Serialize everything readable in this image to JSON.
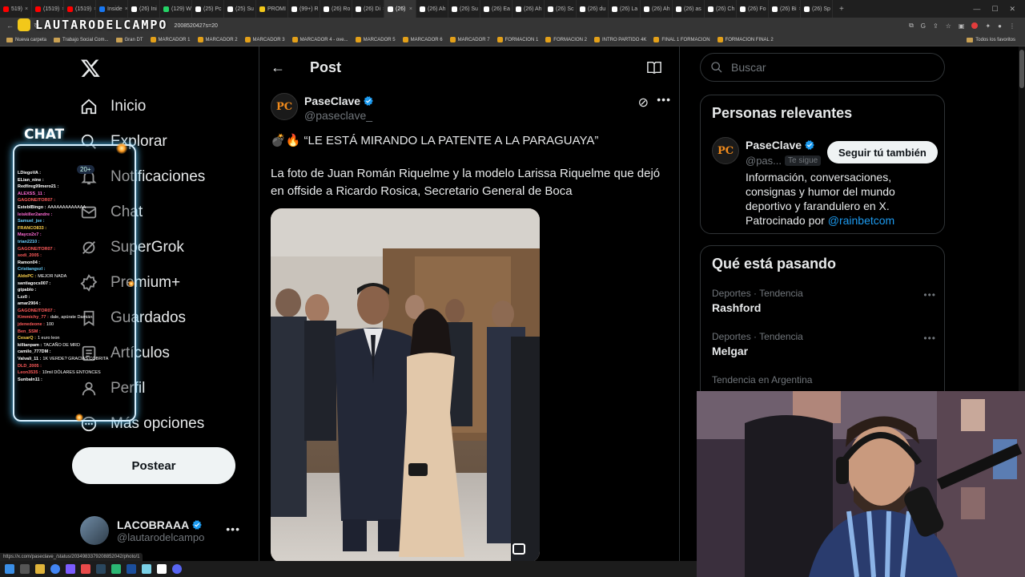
{
  "browser": {
    "tabs": [
      {
        "label": "519)",
        "color": "#ff0000"
      },
      {
        "label": "(1519)",
        "color": "#ff0000"
      },
      {
        "label": "(1519)",
        "color": "#ff0000"
      },
      {
        "label": "Inside",
        "color": "#1877f2"
      },
      {
        "label": "(26) Ini",
        "color": "#ffffff"
      },
      {
        "label": "(129) W",
        "color": "#25d366"
      },
      {
        "label": "(25) Pc",
        "color": "#ffffff"
      },
      {
        "label": "(25) Su",
        "color": "#ffffff"
      },
      {
        "label": "PROMI",
        "color": "#f2c81a"
      },
      {
        "label": "(99+) R",
        "color": "#ffffff"
      },
      {
        "label": "(26) Ro",
        "color": "#ffffff"
      },
      {
        "label": "(26) Di",
        "color": "#ffffff"
      },
      {
        "label": "(26)",
        "color": "#ffffff",
        "active": true
      },
      {
        "label": "(26) Ah",
        "color": "#ffffff"
      },
      {
        "label": "(26) Su",
        "color": "#ffffff"
      },
      {
        "label": "(26) Ea",
        "color": "#ffffff"
      },
      {
        "label": "(26) Ah",
        "color": "#ffffff"
      },
      {
        "label": "(26) Sc",
        "color": "#ffffff"
      },
      {
        "label": "(26) du",
        "color": "#ffffff"
      },
      {
        "label": "(26) La",
        "color": "#ffffff"
      },
      {
        "label": "(26) Ah",
        "color": "#ffffff"
      },
      {
        "label": "(26) as",
        "color": "#ffffff"
      },
      {
        "label": "(26) Ch",
        "color": "#ffffff"
      },
      {
        "label": "(26) Fo",
        "color": "#ffffff"
      },
      {
        "label": "(26) Bi",
        "color": "#ffffff"
      },
      {
        "label": "(26) Sp",
        "color": "#ffffff"
      }
    ],
    "url": "2008520427s=20",
    "bookmarks": [
      "Nueva carpeta",
      "Trabajo Social Com...",
      "Gran DT",
      "MARCADOR 1",
      "MARCADOR 2",
      "MARCADOR 3",
      "MARCADOR 4 - ove...",
      "MARCADOR 5",
      "MARCADOR 6",
      "MARCADOR 7",
      "FORMACION 1",
      "FORMACION 2",
      "INTRO PARTIDO 4K",
      "FINAL 1 FORMACION",
      "FORMACION FINAL 2"
    ],
    "all_bookmarks": "Todos los favoritos",
    "status_url": "https://x.com/paseclave_/status/2034983379208852042/photo/1"
  },
  "nav": {
    "items": [
      {
        "label": "Inicio",
        "icon": "home-icon"
      },
      {
        "label": "Explorar",
        "icon": "search-icon"
      },
      {
        "label": "Notificaciones",
        "icon": "bell-icon"
      },
      {
        "label": "Chat",
        "icon": "mail-icon"
      },
      {
        "label": "SuperGrok",
        "icon": "grok-icon"
      },
      {
        "label": "Premium+",
        "icon": "premium-icon"
      },
      {
        "label": "Guardados",
        "icon": "bookmark-icon"
      },
      {
        "label": "Artículos",
        "icon": "article-icon"
      },
      {
        "label": "Perfil",
        "icon": "profile-icon"
      },
      {
        "label": "Más opciones",
        "icon": "more-icon"
      }
    ],
    "post_button": "Postear",
    "account": {
      "name": "LACOBRAAA",
      "handle": "@lautarodelcampo"
    }
  },
  "post": {
    "header": "Post",
    "author": {
      "name": "PaseClave",
      "handle": "@paseclave_",
      "avatar_text": "PC"
    },
    "title": "💣🔥 “LE ESTÁ MIRANDO LA PATENTE A LA PARAGUAYA”",
    "body": "La foto de Juan Román Riquelme y la modelo Larissa Riquelme que dejó en offside a Ricardo Rosica, Secretario General de Boca"
  },
  "sidebar": {
    "search_placeholder": "Buscar",
    "relevant": {
      "title": "Personas relevantes",
      "name": "PaseClave",
      "handle": "@pas...",
      "follows_you": "Te sigue",
      "follow_button": "Seguir tú también",
      "bio": "Información, conversaciones, consignas y humor del mundo deportivo y farandulero en X. Patrocinado por ",
      "bio_link": "@rainbetcom"
    },
    "trends": {
      "title": "Qué está pasando",
      "items": [
        {
          "meta": "Deportes · Tendencia",
          "name": "Rashford"
        },
        {
          "meta": "Deportes · Tendencia",
          "name": "Melgar"
        },
        {
          "meta": "Tendencia en Argentina",
          "name": ""
        }
      ]
    }
  },
  "overlay": {
    "brand": "LAUTARODELCAMPO",
    "chat_title": "CHAT",
    "chat_count": "20+",
    "chat_lines": [
      {
        "user": "LDiegoVA :",
        "msg": "",
        "color": "#ffffff"
      },
      {
        "user": "ELian_nine :",
        "msg": "",
        "color": "#ffffff"
      },
      {
        "user": "Redfireg99mero21 :",
        "msg": "",
        "color": "#ffffff"
      },
      {
        "user": "ALEXSS_11 :",
        "msg": "",
        "color": "#ff6ad5"
      },
      {
        "user": "GAGONEITOR07 :",
        "msg": "",
        "color": "#ff5a5a"
      },
      {
        "user": "EstebIBingo :",
        "msg": "AAAAAAAAAAAAA",
        "color": "#ffffff"
      },
      {
        "user": "leiskiller2andre :",
        "msg": "",
        "color": "#ff6ad5"
      },
      {
        "user": "Samuel_jse :",
        "msg": "",
        "color": "#6ad0ff"
      },
      {
        "user": "FRANCO833 :",
        "msg": "",
        "color": "#ffd34d"
      },
      {
        "user": "Mayco2x7 :",
        "msg": "",
        "color": "#ff6ad5"
      },
      {
        "user": "trian2210 :",
        "msg": "",
        "color": "#6ad0ff"
      },
      {
        "user": "GAGONEITOR07 :",
        "msg": "",
        "color": "#ff5a5a"
      },
      {
        "user": "sodi_2005 :",
        "msg": "",
        "color": "#ff5a5a"
      },
      {
        "user": "Ramon04 :",
        "msg": "",
        "color": "#ffffff"
      },
      {
        "user": "Cristiangvzl :",
        "msg": "",
        "color": "#6ad0ff"
      },
      {
        "user": "AldoPC :",
        "msg": "MEJOR NADA",
        "color": "#ffd34d"
      },
      {
        "user": "santiagocs007 :",
        "msg": "",
        "color": "#ffffff"
      },
      {
        "user": "gtpablo :",
        "msg": "",
        "color": "#ffffff"
      },
      {
        "user": "Lzz0 :",
        "msg": "",
        "color": "#ffffff"
      },
      {
        "user": "amar2904 :",
        "msg": "",
        "color": "#ffffff"
      },
      {
        "user": "GAGONEITOR07 :",
        "msg": "",
        "color": "#ff5a5a"
      },
      {
        "user": "Kimmichy_77 :",
        "msg": "dale, apúrate Damián",
        "color": "#ff5a5a"
      },
      {
        "user": "jdenedeone :",
        "msg": "100",
        "color": "#ff5a5a"
      },
      {
        "user": "Ben_SSM :",
        "msg": "",
        "color": "#ff5a5a"
      },
      {
        "user": "CesarQ :",
        "msg": "1 euro leon",
        "color": "#ffd34d"
      },
      {
        "user": "killianpam :",
        "msg": "TACAÑO DE MRD",
        "color": "#ffffff"
      },
      {
        "user": "camilo_777DM :",
        "msg": "",
        "color": "#ffffff"
      },
      {
        "user": "Valvali_11 :",
        "msg": "1K VERDE? GRACIAS COBRITA",
        "color": "#ffffff"
      },
      {
        "user": "DLD_2005 :",
        "msg": "",
        "color": "#ff5a5a"
      },
      {
        "user": "Leon3535 :",
        "msg": "10mil DÓLARES ENTONCES",
        "color": "#ff5a5a"
      },
      {
        "user": "Sunbaln11 :",
        "msg": "",
        "color": "#ffffff"
      }
    ]
  },
  "colors": {
    "accent": "#1d9bf0",
    "background": "#000000",
    "border": "#2f3336",
    "muted": "#71767b",
    "text": "#e7e9ea",
    "avatar_orange": "#f08a1c"
  }
}
